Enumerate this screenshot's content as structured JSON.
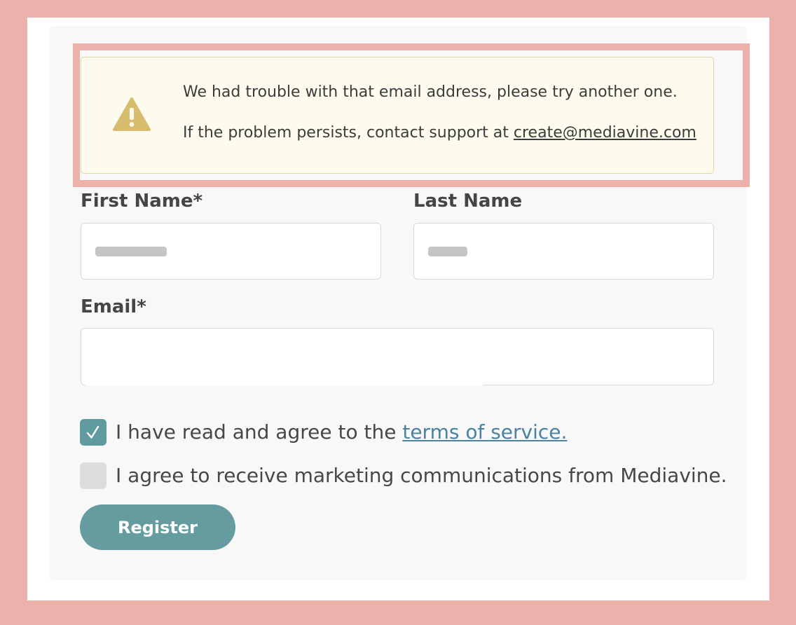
{
  "alert": {
    "icon": "warning-triangle-icon",
    "icon_color": "#d9bd6e",
    "message": "We had trouble with that email address, please try another one.",
    "support_prefix": "If the problem persists, contact support at ",
    "support_email": "create@mediavine.com"
  },
  "form": {
    "first_name_label": "First Name*",
    "last_name_label": "Last Name",
    "email_label": "Email*",
    "terms_prefix": "I have read and agree to the ",
    "terms_link": "terms of service.",
    "terms_checked": true,
    "marketing_label": "I agree to receive marketing communications from Mediavine.",
    "marketing_checked": false,
    "register_label": "Register"
  },
  "colors": {
    "page_background": "#ebb1aa",
    "accent": "#659ca0",
    "link": "#4a82a1",
    "alert_background": "#fcfbee"
  }
}
